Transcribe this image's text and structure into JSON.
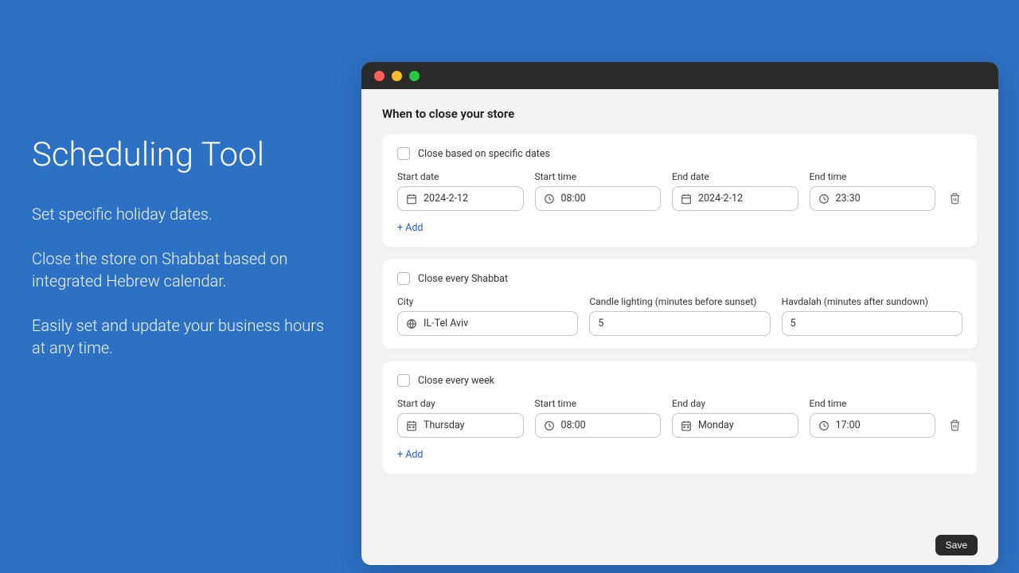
{
  "promo": {
    "title": "Scheduling Tool",
    "line1": "Set specific holiday dates.",
    "line2": "Close the store on Shabbat based on integrated Hebrew calendar.",
    "line3": "Easily set and update your business hours at any time."
  },
  "page": {
    "title": "When to close your store"
  },
  "specific_dates": {
    "heading": "Close based on specific dates",
    "fields": {
      "start_date_label": "Start date",
      "start_date_value": "2024-2-12",
      "start_time_label": "Start time",
      "start_time_value": "08:00",
      "end_date_label": "End date",
      "end_date_value": "2024-2-12",
      "end_time_label": "End time",
      "end_time_value": "23:30"
    },
    "add_label": "+ Add"
  },
  "shabbat": {
    "heading": "Close every Shabbat",
    "fields": {
      "city_label": "City",
      "city_value": "IL-Tel Aviv",
      "candle_label": "Candle lighting (minutes before sunset)",
      "candle_value": "5",
      "havdalah_label": "Havdalah (minutes after sundown)",
      "havdalah_value": "5"
    }
  },
  "weekly": {
    "heading": "Close every week",
    "fields": {
      "start_day_label": "Start day",
      "start_day_value": "Thursday",
      "start_time_label": "Start time",
      "start_time_value": "08:00",
      "end_day_label": "End day",
      "end_day_value": "Monday",
      "end_time_label": "End time",
      "end_time_value": "17:00"
    },
    "add_label": "+ Add"
  },
  "save_label": "Save"
}
